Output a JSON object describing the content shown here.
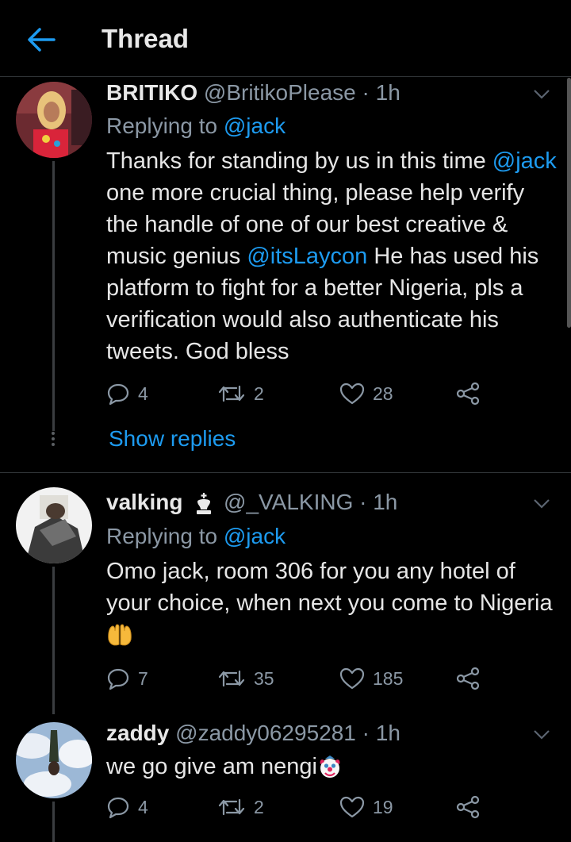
{
  "header": {
    "title": "Thread"
  },
  "tweets": [
    {
      "name": "BRITIKO",
      "handle": "@BritikoPlease",
      "time": "1h",
      "replying_prefix": "Replying to ",
      "replying_to": "@jack",
      "text_parts": {
        "a": "Thanks for standing by us in this time ",
        "mention1": "@jack",
        "b": " one more crucial thing, please help verify the handle of one of our best creative & music genius ",
        "mention2": "@itsLaycon",
        "c": " He has used his platform to fight for a better Nigeria, pls a verification would also authenticate his tweets. God bless"
      },
      "replies": "4",
      "retweets": "2",
      "likes": "28",
      "show_replies": "Show replies"
    },
    {
      "name": "valking",
      "handle": "@_VALKING",
      "time": "1h",
      "replying_prefix": "Replying to ",
      "replying_to": "@jack",
      "text": "Omo jack, room 306 for you any hotel of your choice, when next you come to Nigeria",
      "replies": "7",
      "retweets": "35",
      "likes": "185"
    },
    {
      "name": "zaddy",
      "handle": "@zaddy06295281",
      "time": "1h",
      "text": "we go give am nengi",
      "replies": "4",
      "retweets": "2",
      "likes": "19"
    }
  ],
  "icons": {
    "back": "arrow-left-icon",
    "reply": "reply-icon",
    "retweet": "retweet-icon",
    "like": "heart-icon",
    "share": "share-icon",
    "caret": "chevron-down-icon",
    "crown": "chess-king-icon",
    "hands": "palms-up-together-emoji",
    "clown": "clown-face-emoji"
  },
  "colors": {
    "accent": "#1d9bf0",
    "background": "#000000",
    "muted": "#8b98a5"
  }
}
